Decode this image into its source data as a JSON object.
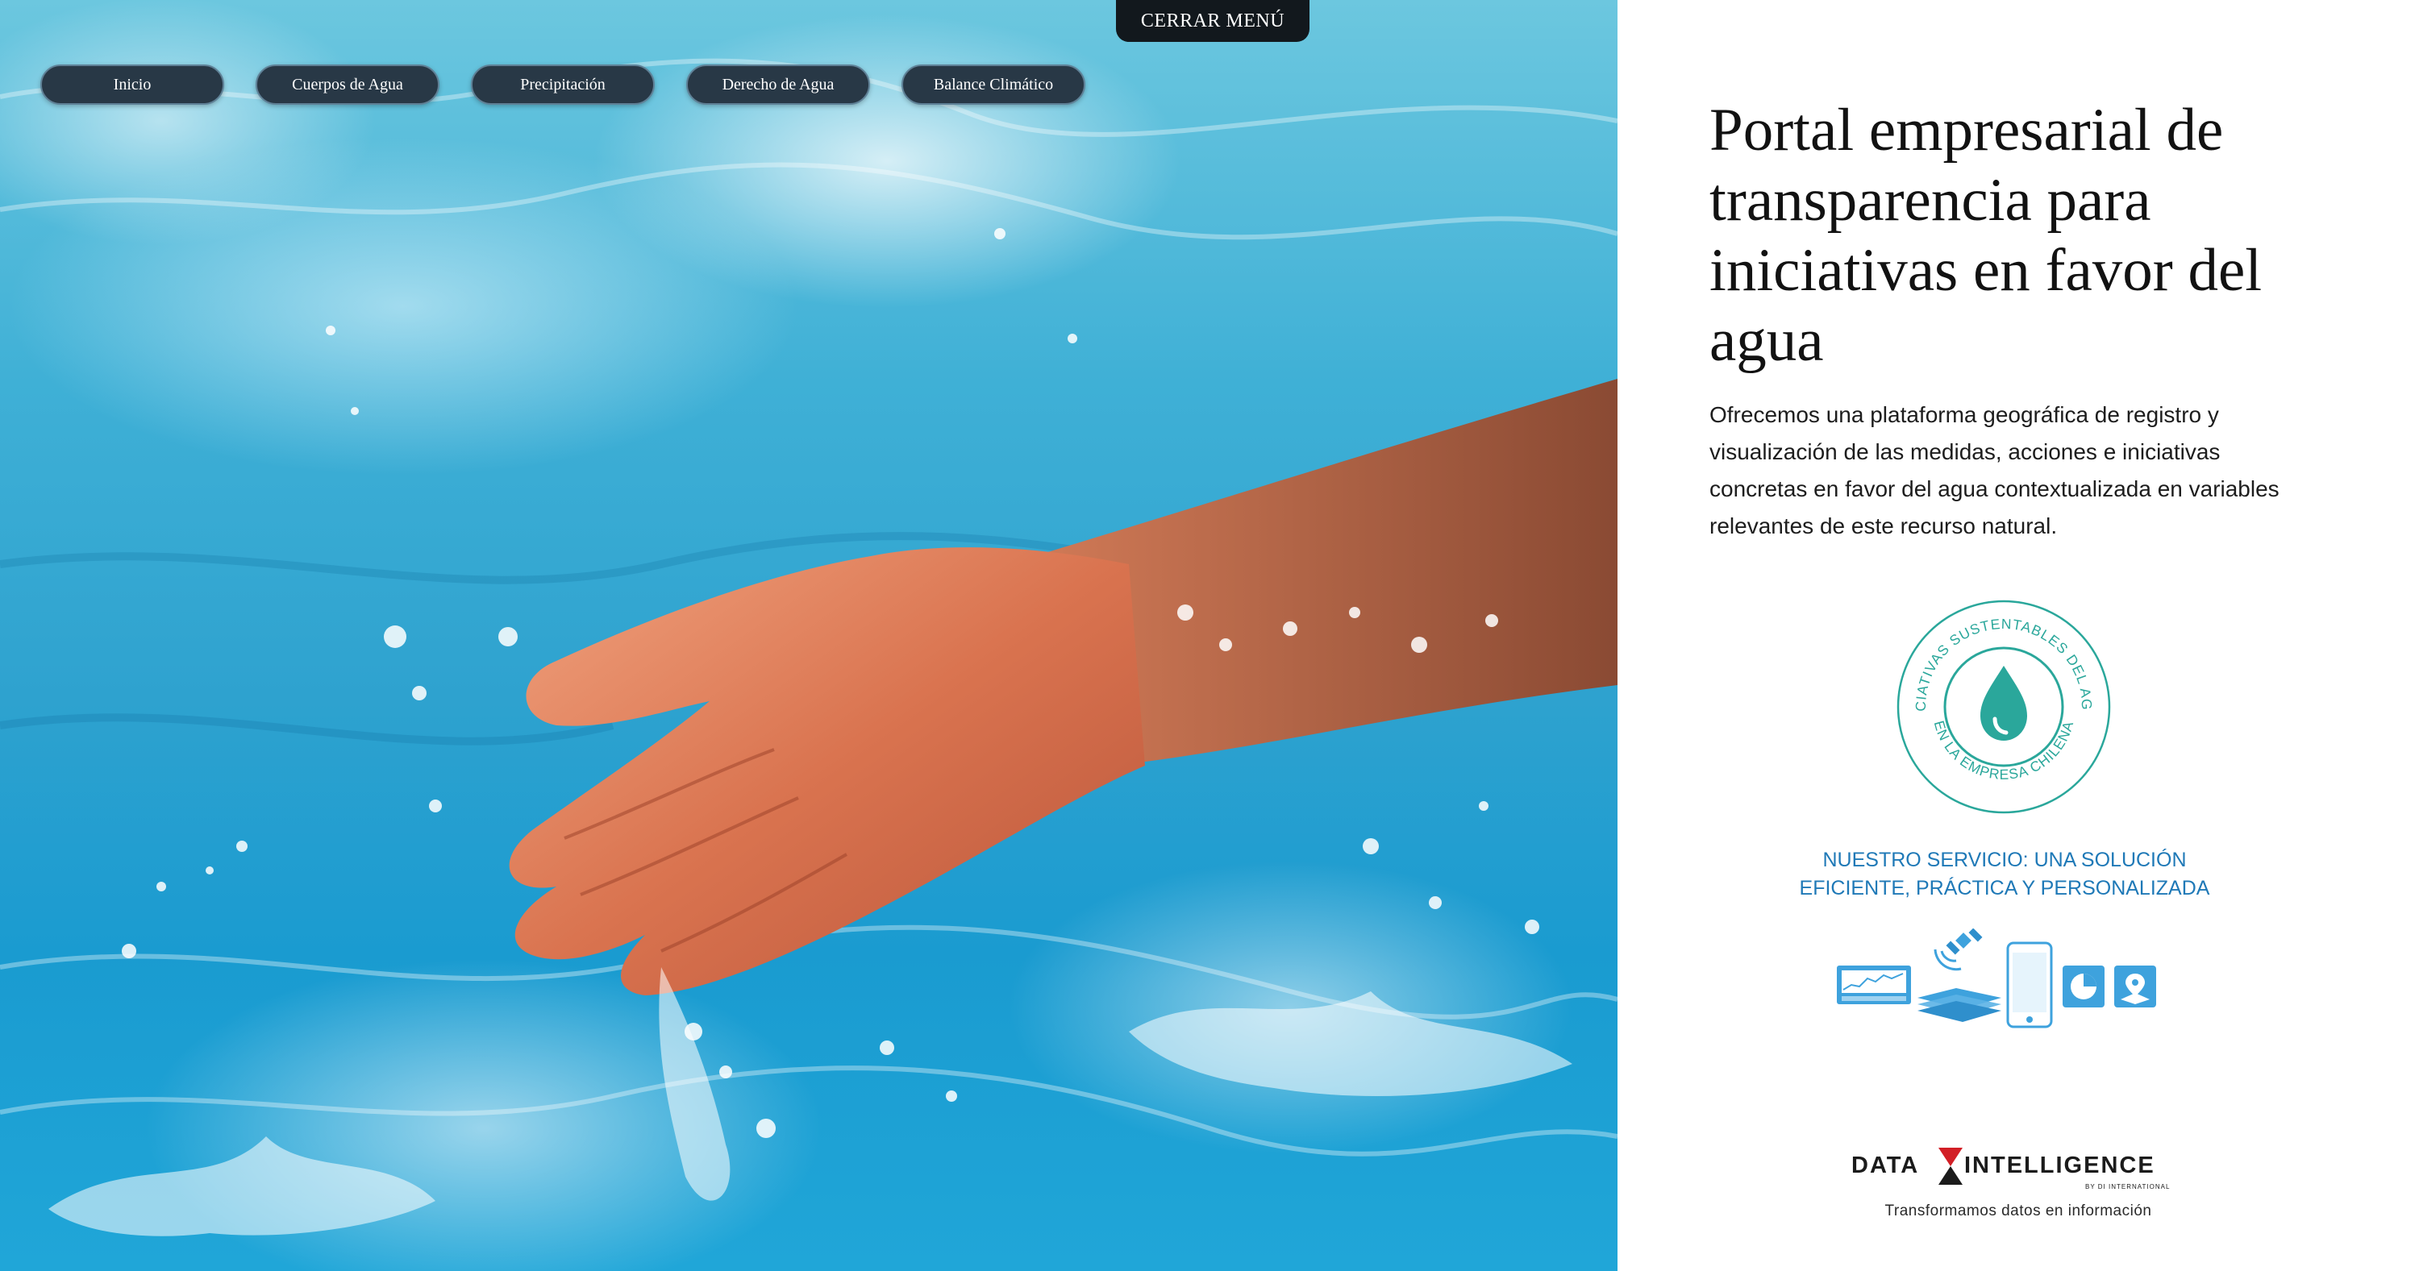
{
  "menu": {
    "close_label": "CERRAR MENÚ"
  },
  "nav": {
    "items": [
      {
        "label": "Inicio"
      },
      {
        "label": "Cuerpos de Agua"
      },
      {
        "label": "Precipitación"
      },
      {
        "label": "Derecho de Agua"
      },
      {
        "label": "Balance Climático"
      }
    ]
  },
  "hero": {
    "image": "hand-in-water-photo"
  },
  "panel": {
    "title": "Portal empresarial de transparencia para iniciativas en favor del agua",
    "description": "Ofrecemos una plataforma geográfica de registro y visualización de las medidas, acciones e iniciativas concretas en favor del agua contextualizada en variables relevantes de este recurso natural.",
    "seal": {
      "top_text": "INICIATIVAS SUSTENTABLES DEL AGUA",
      "bottom_text": "EN LA EMPRESA CHILENA",
      "icon": "water-drop-icon",
      "color": "#2aa79b"
    },
    "service": {
      "line1": "NUESTRO SERVICIO: UNA SOLUCIÓN",
      "line2": "EFICIENTE, PRÁCTICA Y PERSONALIZADA",
      "color": "#1f79b7"
    },
    "service_icons": [
      "dashboard-icon",
      "layers-icon",
      "satellite-icon",
      "smartphone-icon",
      "pie-chart-icon",
      "map-pin-icon"
    ],
    "brand": {
      "name_left": "DATA",
      "name_right": "INTELLIGENCE",
      "byline": "BY DI INTERNATIONAL",
      "tagline": "Transformamos datos en información",
      "accent": "#d21f26"
    }
  }
}
